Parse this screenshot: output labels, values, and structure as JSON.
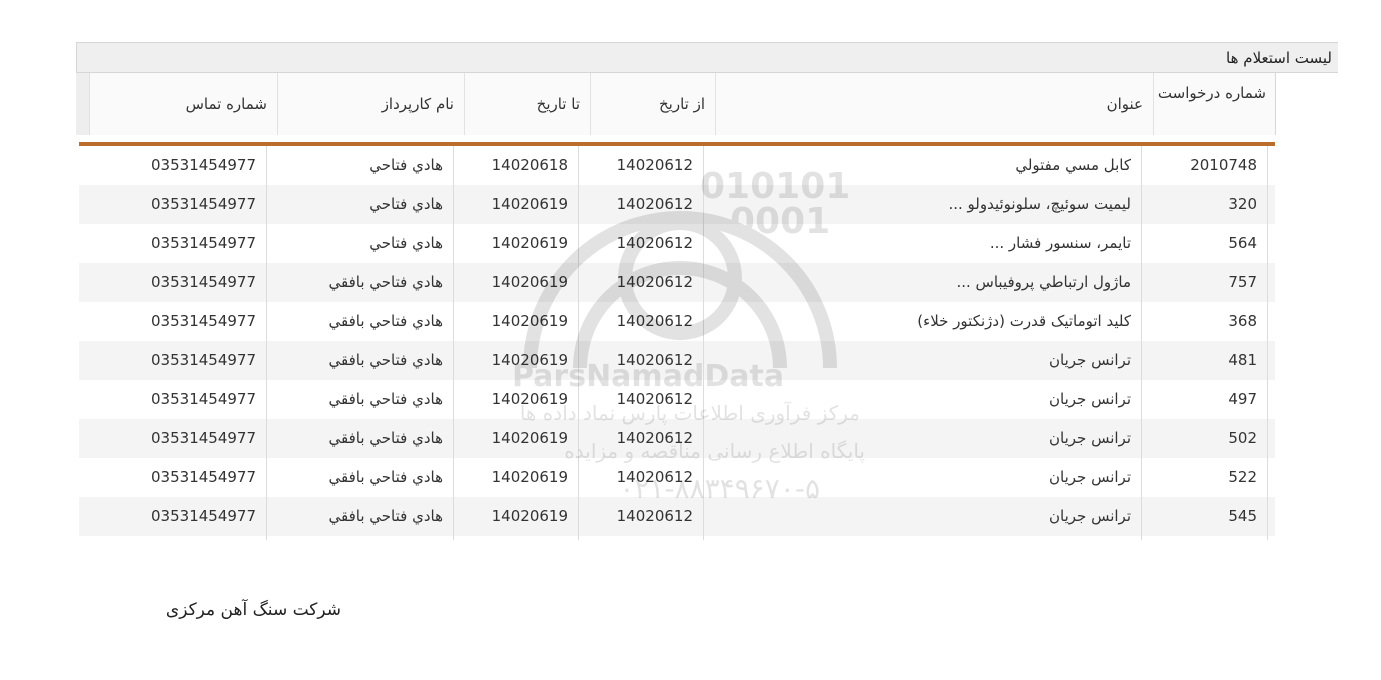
{
  "panel": {
    "title": "ليست استعلام ها"
  },
  "table": {
    "headers": {
      "request_no": "شماره درخواست",
      "title": "عنوان",
      "from_date": "از تاريخ",
      "to_date": "تا تاريخ",
      "agent": "نام کارپرداز",
      "contact": "شماره تماس"
    },
    "rows": [
      {
        "request_no": "2010748",
        "title": "كابل مسي مفتولي",
        "from_date": "14020612",
        "to_date": "14020618",
        "agent": "هادي فتاحي",
        "contact": "03531454977"
      },
      {
        "request_no": "320",
        "title": "ليميت سوئيچ، سلونوئيدولو ...",
        "from_date": "14020612",
        "to_date": "14020619",
        "agent": "هادي فتاحي",
        "contact": "03531454977"
      },
      {
        "request_no": "564",
        "title": "تايمر، سنسور فشار ...",
        "from_date": "14020612",
        "to_date": "14020619",
        "agent": "هادي فتاحي",
        "contact": "03531454977"
      },
      {
        "request_no": "757",
        "title": "ماژول ارتباطي پروفيباس ...",
        "from_date": "14020612",
        "to_date": "14020619",
        "agent": "هادي فتاحي بافقي",
        "contact": "03531454977"
      },
      {
        "request_no": "368",
        "title": "كليد اتوماتيک قدرت (دژنكتور خلاء)",
        "from_date": "14020612",
        "to_date": "14020619",
        "agent": "هادي فتاحي بافقي",
        "contact": "03531454977"
      },
      {
        "request_no": "481",
        "title": "ترانس جريان",
        "from_date": "14020612",
        "to_date": "14020619",
        "agent": "هادي فتاحي بافقي",
        "contact": "03531454977"
      },
      {
        "request_no": "497",
        "title": "ترانس جريان",
        "from_date": "14020612",
        "to_date": "14020619",
        "agent": "هادي فتاحي بافقي",
        "contact": "03531454977"
      },
      {
        "request_no": "502",
        "title": "ترانس جريان",
        "from_date": "14020612",
        "to_date": "14020619",
        "agent": "هادي فتاحي بافقي",
        "contact": "03531454977"
      },
      {
        "request_no": "522",
        "title": "ترانس جريان",
        "from_date": "14020612",
        "to_date": "14020619",
        "agent": "هادي فتاحي بافقي",
        "contact": "03531454977"
      },
      {
        "request_no": "545",
        "title": "ترانس جريان",
        "from_date": "14020612",
        "to_date": "14020619",
        "agent": "هادي فتاحي بافقي",
        "contact": "03531454977"
      }
    ]
  },
  "watermark": {
    "brand": "ParsNamadData",
    "binary_1": "010101",
    "binary_2": "0001",
    "line_fa": "مرکز فرآوری اطلاعات پارس نماد داده ها",
    "line_fa_2": "پایگاه اطلاع رسانی مناقصه و مزایده",
    "phone": "۰۲۱-۸۸۳۴۹۶۷۰-۵"
  },
  "footer": {
    "company": "شرکت سنگ آهن مرکزی"
  },
  "colors": {
    "accent": "#b86f2c",
    "header_bg": "#efefef",
    "row_alt": "#f4f4f4"
  }
}
